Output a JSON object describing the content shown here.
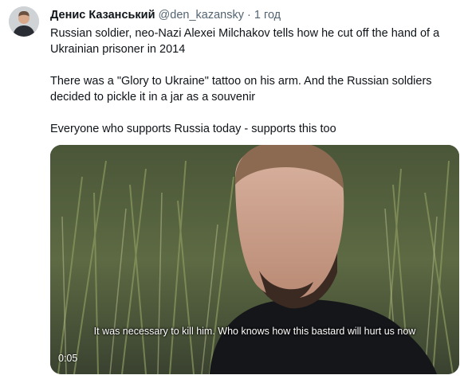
{
  "tweet": {
    "author": {
      "display_name": "Денис Казанський",
      "handle": "@den_kazansky",
      "separator": "·",
      "time": "1 год",
      "avatar_icon": "user-avatar"
    },
    "text": {
      "p1": "Russian soldier, neo-Nazi Alexei Milchakov tells how he cut off the hand of a Ukrainian prisoner in 2014",
      "p2": "There was a \"Glory to Ukraine\" tattoo on his arm. And the Russian soldiers decided to pickle it in a jar as a souvenir",
      "p3": "Everyone who supports Russia today - supports this too"
    },
    "media": {
      "subtitle": "It was necessary to kill him. Who knows how this bastard will hurt us now",
      "duration": "0:05"
    }
  },
  "colors": {
    "text_primary": "#0f1419",
    "text_secondary": "#536471",
    "background": "#ffffff"
  }
}
